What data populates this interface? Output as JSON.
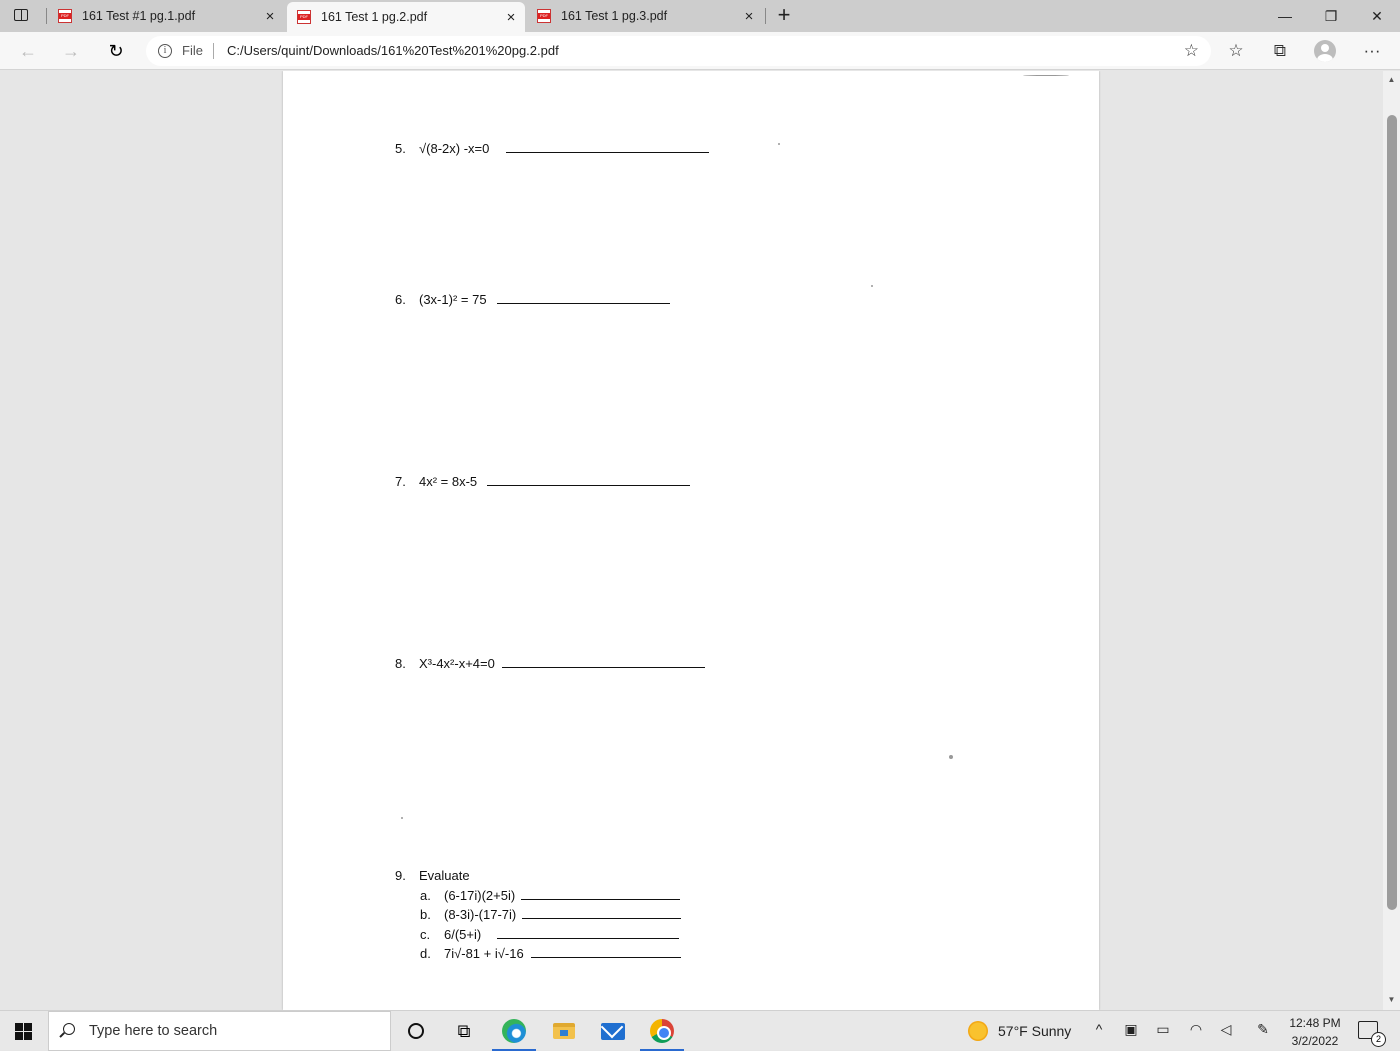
{
  "browser": {
    "tabs": [
      {
        "title": "161 Test #1 pg.1.pdf",
        "active": false
      },
      {
        "title": "161 Test 1 pg.2.pdf",
        "active": true
      },
      {
        "title": "161 Test 1 pg.3.pdf",
        "active": false
      }
    ],
    "close_glyph": "×",
    "new_tab_glyph": "+",
    "window_buttons": {
      "minimize": "—",
      "restore": "❐",
      "close": "✕"
    },
    "address": {
      "scheme_label": "File",
      "url": "C:/Users/quint/Downloads/161%20Test%201%20pg.2.pdf"
    },
    "nav": {
      "back": "←",
      "forward": "→",
      "refresh": "↻"
    },
    "toolbar_icons": {
      "favorite": "☆",
      "favorites": "☆",
      "collections": "⧉",
      "more": "···"
    }
  },
  "document": {
    "questions": [
      {
        "num": "5.",
        "text": "√(8-2x) -x=0"
      },
      {
        "num": "6.",
        "text": "(3x-1)² = 75"
      },
      {
        "num": "7.",
        "text": "4x² = 8x-5"
      },
      {
        "num": "8.",
        "text": "X³-4x²-x+4=0"
      },
      {
        "num": "9.",
        "text": "Evaluate"
      }
    ],
    "subparts": [
      {
        "letter": "a.",
        "text": "(6-17i)(2+5i)"
      },
      {
        "letter": "b.",
        "text": "(8-3i)-(17-7i)"
      },
      {
        "letter": "c.",
        "text": "6/(5+i)"
      },
      {
        "letter": "d.",
        "text": "7i√-81 + i√-16"
      }
    ]
  },
  "scrollbar": {
    "up": "▲",
    "down": "▼"
  },
  "taskbar": {
    "search_placeholder": "Type here to search",
    "weather": "57°F  Sunny",
    "time": "12:48 PM",
    "date": "3/2/2022",
    "notifications_count": "2",
    "tray_icons": [
      "chevron-up-icon",
      "meet-now-icon",
      "battery-icon",
      "wifi-icon",
      "volume-icon",
      "pen-icon"
    ]
  }
}
